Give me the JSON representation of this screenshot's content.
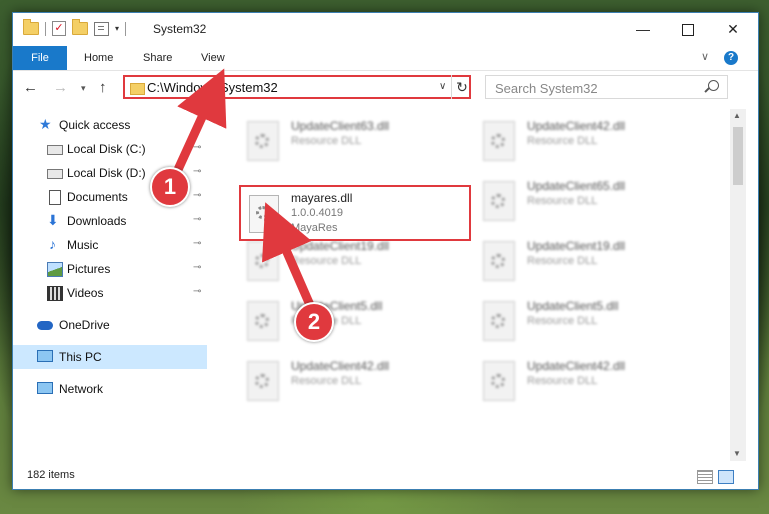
{
  "window": {
    "title": "System32",
    "controls": {
      "minimize": "—",
      "maximize": "",
      "close": "✕"
    }
  },
  "ribbon": {
    "file": "File",
    "home": "Home",
    "share": "Share",
    "view": "View",
    "expand": "∨",
    "help": "?"
  },
  "nav": {
    "back": "←",
    "forward": "→",
    "recent": "▾",
    "up": "↑",
    "address": "C:\\Windows\\System32",
    "address_dropdown": "∨",
    "refresh": "↻",
    "search_placeholder": "Search System32"
  },
  "sidebar": {
    "items": [
      {
        "label": "Quick access",
        "pinned": false
      },
      {
        "label": "Local Disk (C:)",
        "pinned": true
      },
      {
        "label": "Local Disk (D:)",
        "pinned": true
      },
      {
        "label": "Documents",
        "pinned": true
      },
      {
        "label": "Downloads",
        "pinned": true
      },
      {
        "label": "Music",
        "pinned": true
      },
      {
        "label": "Pictures",
        "pinned": true
      },
      {
        "label": "Videos",
        "pinned": true
      },
      {
        "label": "OneDrive",
        "pinned": false
      },
      {
        "label": "This PC",
        "pinned": false
      },
      {
        "label": "Network",
        "pinned": false
      }
    ],
    "pin_glyph": "📌"
  },
  "files": {
    "tiles": [
      {
        "name": "UpdateClient63.dll",
        "type": "Resource DLL"
      },
      {
        "name": "UpdateClient42.dll",
        "type": "Resource DLL"
      },
      {
        "name": "UpdateClient65.dll",
        "type": "Resource DLL"
      },
      {
        "name": "UpdateClient19.dll",
        "type": "Resource DLL"
      },
      {
        "name": "UpdateClient19.dll",
        "type": "Resource DLL"
      },
      {
        "name": "UpdateClient5.dll",
        "type": "Resource DLL"
      },
      {
        "name": "UpdateClient5.dll",
        "type": "Resource DLL"
      },
      {
        "name": "UpdateClient42.dll",
        "type": "Resource DLL"
      },
      {
        "name": "UpdateClient42.dll",
        "type": "Resource DLL"
      }
    ],
    "selected": {
      "name": "mayares.dll",
      "version": "1.0.0.4019",
      "description": "MayaRes"
    }
  },
  "status": {
    "item_count": "182 items"
  },
  "annotations": {
    "step1": "1",
    "step2": "2",
    "color": "#e0393e"
  },
  "scroll": {
    "up": "▲",
    "down": "▼"
  }
}
